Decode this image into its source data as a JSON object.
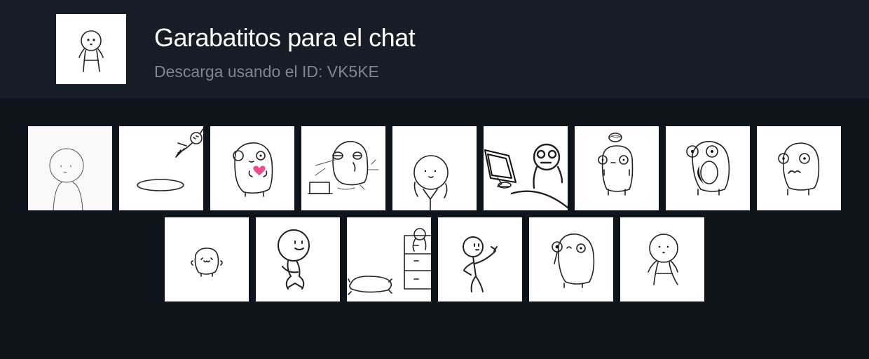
{
  "pack": {
    "title": "Garabatitos para el chat",
    "subtitle": "Descarga usando el ID: VK5KE",
    "icon": "stick-figure-doodle-icon"
  },
  "colors": {
    "background": "#0e141b",
    "header_background": "#161d26",
    "title": "#ffffff",
    "subtitle": "#7e8690",
    "sticker_background": "#ffffff"
  },
  "stickers": [
    {
      "name": "sticker-bald-figure-bust-icon"
    },
    {
      "name": "sticker-figure-jumping-into-hole-icon"
    },
    {
      "name": "sticker-blob-holding-heart-icon"
    },
    {
      "name": "sticker-blob-sleepy-laptop-icon"
    },
    {
      "name": "sticker-round-head-figure-icon"
    },
    {
      "name": "sticker-figure-at-computer-icon"
    },
    {
      "name": "sticker-blob-dizzy-icon"
    },
    {
      "name": "sticker-blob-shocked-icon"
    },
    {
      "name": "sticker-blob-worried-icon"
    },
    {
      "name": "sticker-small-blob-happy-icon"
    },
    {
      "name": "sticker-stick-figure-sitting-icon"
    },
    {
      "name": "sticker-figure-on-drawers-pillow-icon"
    },
    {
      "name": "sticker-stick-figure-pointing-icon"
    },
    {
      "name": "sticker-blob-monocle-icon"
    },
    {
      "name": "sticker-stick-figure-standing-icon"
    }
  ]
}
